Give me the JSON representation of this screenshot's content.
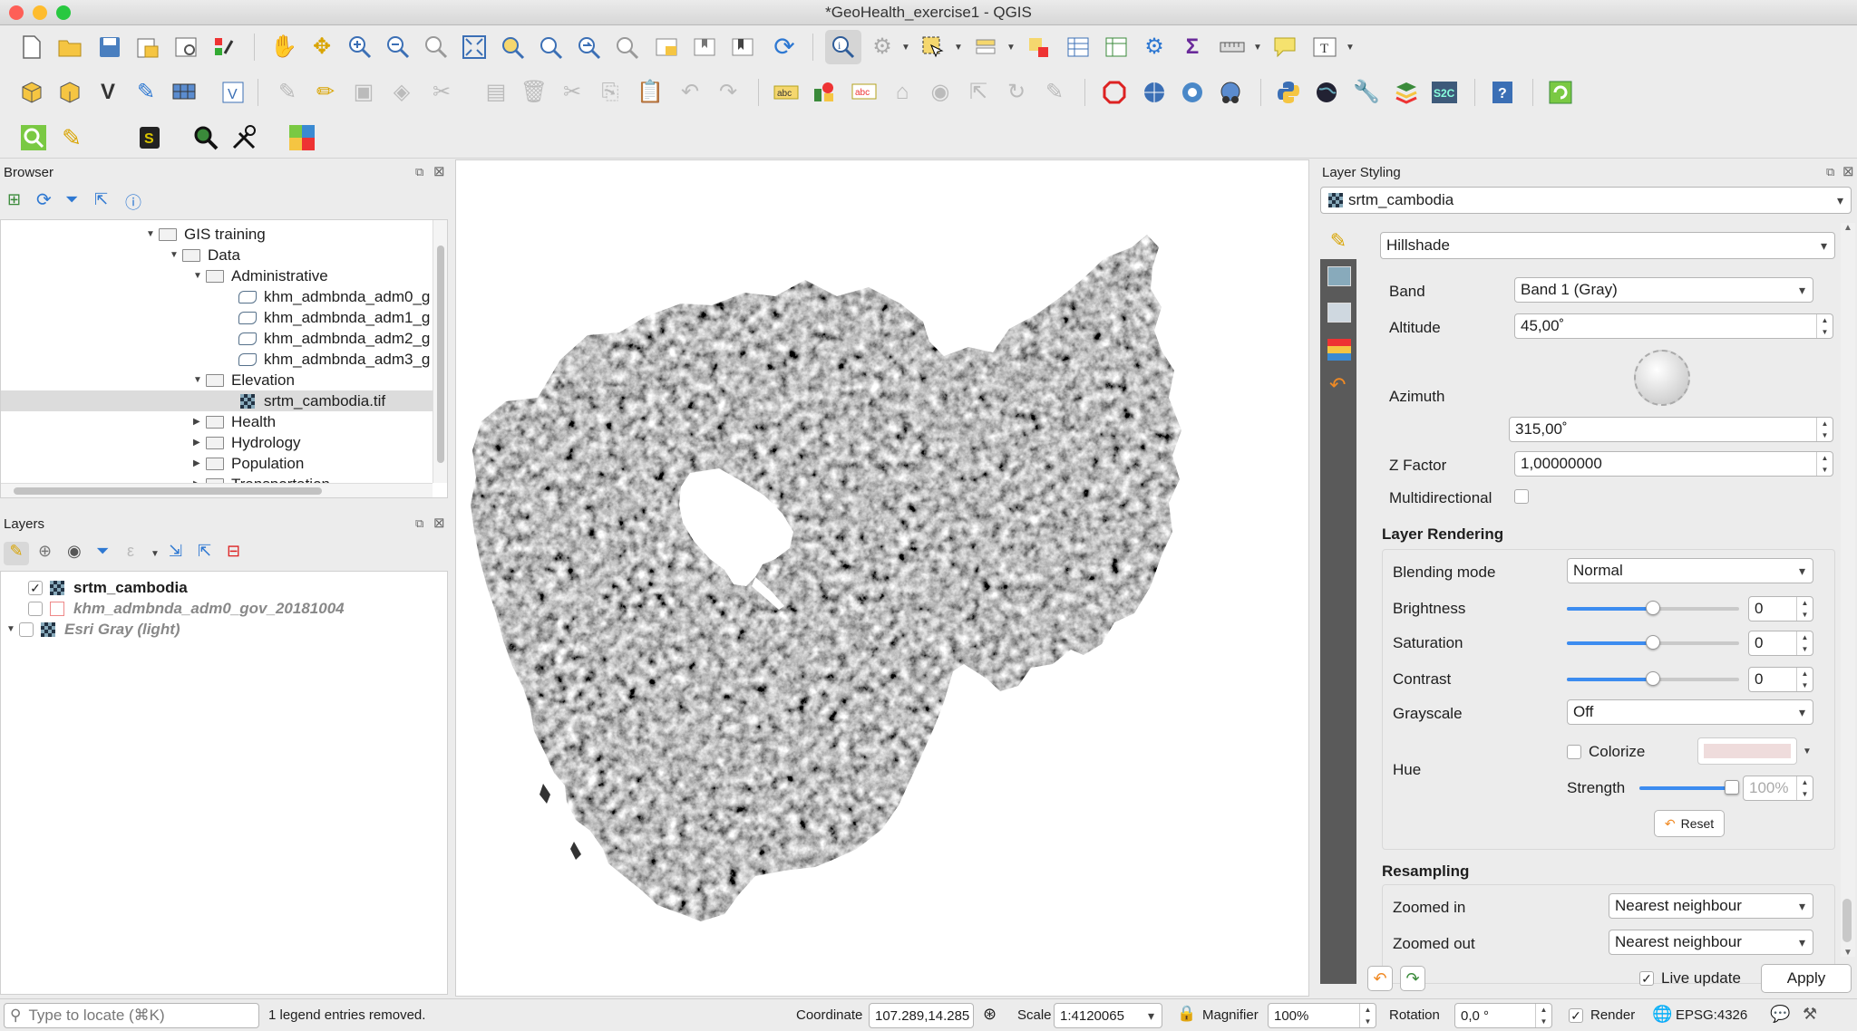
{
  "window": {
    "title": "*GeoHealth_exercise1 - QGIS"
  },
  "toolbar_icons": [
    "new-project",
    "open-project",
    "save-project",
    "save-as",
    "layout-manager",
    "style-manager",
    "pan",
    "pan-to-selection",
    "zoom-in",
    "zoom-out",
    "zoom-native",
    "zoom-full",
    "zoom-layer",
    "zoom-selection",
    "zoom-last",
    "zoom-next",
    "new-map-view",
    "new-bookmark",
    "show-bookmarks",
    "refresh",
    "identify",
    "actions",
    "select-features",
    "select-by-value",
    "deselect",
    "attribute-table",
    "field-calculator",
    "statistics",
    "processing-toolbox",
    "measure",
    "map-tips",
    "text-annotation"
  ],
  "browser": {
    "title": "Browser",
    "items": [
      {
        "label": "GIS training",
        "type": "folder",
        "expanded": true,
        "level": 0
      },
      {
        "label": "Data",
        "type": "folder",
        "expanded": true,
        "level": 1
      },
      {
        "label": "Administrative",
        "type": "folder",
        "expanded": true,
        "level": 2
      },
      {
        "label": "khm_admbnda_adm0_g",
        "type": "polygon",
        "level": 3
      },
      {
        "label": "khm_admbnda_adm1_g",
        "type": "polygon",
        "level": 3
      },
      {
        "label": "khm_admbnda_adm2_g",
        "type": "polygon",
        "level": 3
      },
      {
        "label": "khm_admbnda_adm3_g",
        "type": "polygon",
        "level": 3
      },
      {
        "label": "Elevation",
        "type": "folder",
        "expanded": true,
        "level": 2
      },
      {
        "label": "srtm_cambodia.tif",
        "type": "raster",
        "level": 3,
        "selected": true
      },
      {
        "label": "Health",
        "type": "folder",
        "expanded": false,
        "level": 2
      },
      {
        "label": "Hydrology",
        "type": "folder",
        "expanded": false,
        "level": 2
      },
      {
        "label": "Population",
        "type": "folder",
        "expanded": false,
        "level": 2
      },
      {
        "label": "Transportation",
        "type": "folder",
        "expanded": false,
        "level": 2
      }
    ]
  },
  "layers": {
    "title": "Layers",
    "items": [
      {
        "name": "srtm_cambodia",
        "checked": true,
        "style": "bold"
      },
      {
        "name": "khm_admbnda_adm0_gov_20181004",
        "checked": false,
        "style": "italic"
      },
      {
        "name": "Esri Gray (light)",
        "checked": false,
        "style": "italic"
      }
    ]
  },
  "styling": {
    "title": "Layer Styling",
    "layer": "srtm_cambodia",
    "renderer": "Hillshade",
    "band_label": "Band",
    "band_value": "Band 1 (Gray)",
    "altitude_label": "Altitude",
    "altitude_value": "45,00˚",
    "azimuth_label": "Azimuth",
    "azimuth_value": "315,00˚",
    "zfactor_label": "Z Factor",
    "zfactor_value": "1,00000000",
    "multidirectional_label": "Multidirectional",
    "layer_rendering_title": "Layer Rendering",
    "blending_label": "Blending mode",
    "blending_value": "Normal",
    "brightness_label": "Brightness",
    "brightness_value": "0",
    "brightness_level": 0.5,
    "saturation_label": "Saturation",
    "saturation_value": "0",
    "saturation_level": 0.5,
    "contrast_label": "Contrast",
    "contrast_value": "0",
    "contrast_level": 0.5,
    "grayscale_label": "Grayscale",
    "grayscale_value": "Off",
    "hue_label": "Hue",
    "colorize_label": "Colorize",
    "strength_label": "Strength",
    "strength_value": "100%",
    "strength_level": 1.0,
    "reset_label": "Reset",
    "resampling_title": "Resampling",
    "zoomed_in_label": "Zoomed in",
    "zoomed_in_value": "Nearest neighbour",
    "zoomed_out_label": "Zoomed out",
    "zoomed_out_value": "Nearest neighbour",
    "live_update_label": "Live update",
    "apply_label": "Apply"
  },
  "status": {
    "locate_placeholder": "Type to locate (⌘K)",
    "message": "1 legend entries removed.",
    "coordinate_label": "Coordinate",
    "coordinate_value": "107.289,14.285",
    "scale_label": "Scale",
    "scale_value": "1:4120065",
    "magnifier_label": "Magnifier",
    "magnifier_value": "100%",
    "rotation_label": "Rotation",
    "rotation_value": "0,0 °",
    "render_label": "Render",
    "crs": "EPSG:4326"
  }
}
